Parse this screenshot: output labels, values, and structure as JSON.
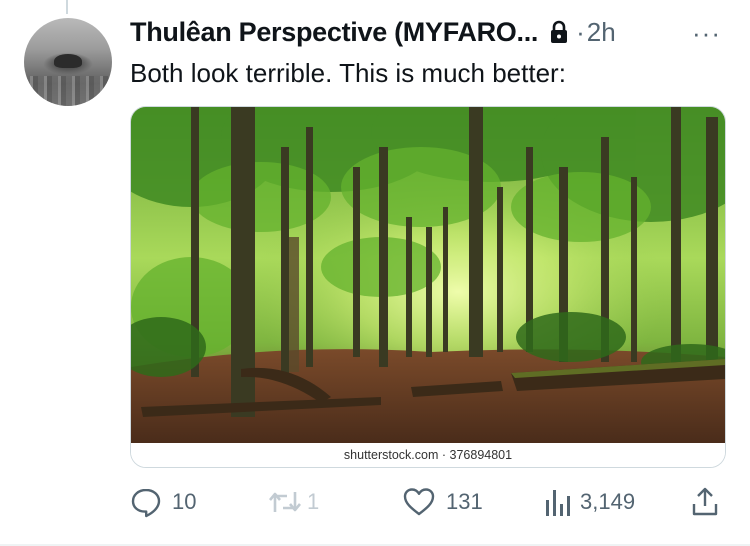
{
  "tweet": {
    "author_name": "Thulêan Perspective (MYFARO...",
    "time_separator": "·",
    "time": "2h",
    "more_label": "···",
    "text": "Both look terrible. This is much better:",
    "media": {
      "caption": "shutterstock.com · 376894801"
    },
    "actions": {
      "replies": "10",
      "retweets": "1",
      "likes": "131",
      "views": "3,149"
    },
    "icons": [
      "lock-icon",
      "more-icon",
      "reply-icon",
      "retweet-icon",
      "like-icon",
      "views-icon",
      "share-icon"
    ]
  },
  "colors": {
    "text": "#0f1419",
    "secondary": "#536471",
    "disabled": "#c2cbd2",
    "border": "#cfd9de"
  }
}
